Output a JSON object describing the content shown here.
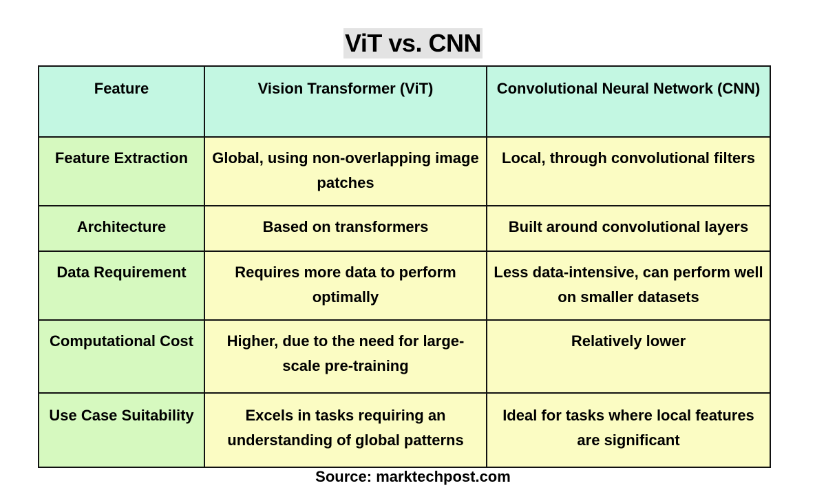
{
  "title": "ViT vs. CNN",
  "table": {
    "headers": [
      "Feature",
      "Vision Transformer (ViT)",
      "Convolutional Neural Network (CNN)"
    ],
    "rows": [
      {
        "feature": "Feature Extraction",
        "vit": "Global, using non-overlapping image patches",
        "cnn": "Local, through convolutional filters"
      },
      {
        "feature": "Architecture",
        "vit": "Based on transformers",
        "cnn": "Built around convolutional layers"
      },
      {
        "feature": "Data Requirement",
        "vit": "Requires more data to perform optimally",
        "cnn": "Less data-intensive, can perform well on smaller datasets"
      },
      {
        "feature": "Computational Cost",
        "vit": "Higher, due to the need for large-scale pre-training",
        "cnn": "Relatively lower"
      },
      {
        "feature": "Use Case Suitability",
        "vit": "Excels in tasks requiring an understanding of global patterns",
        "cnn": "Ideal for tasks where local features are significant"
      }
    ]
  },
  "source": "Source: marktechpost.com",
  "colors": {
    "header_bg": "#c3f7e2",
    "feature_bg": "#d6f9bf",
    "value_bg": "#fbfcc3",
    "title_bg": "#e3e3e3"
  }
}
